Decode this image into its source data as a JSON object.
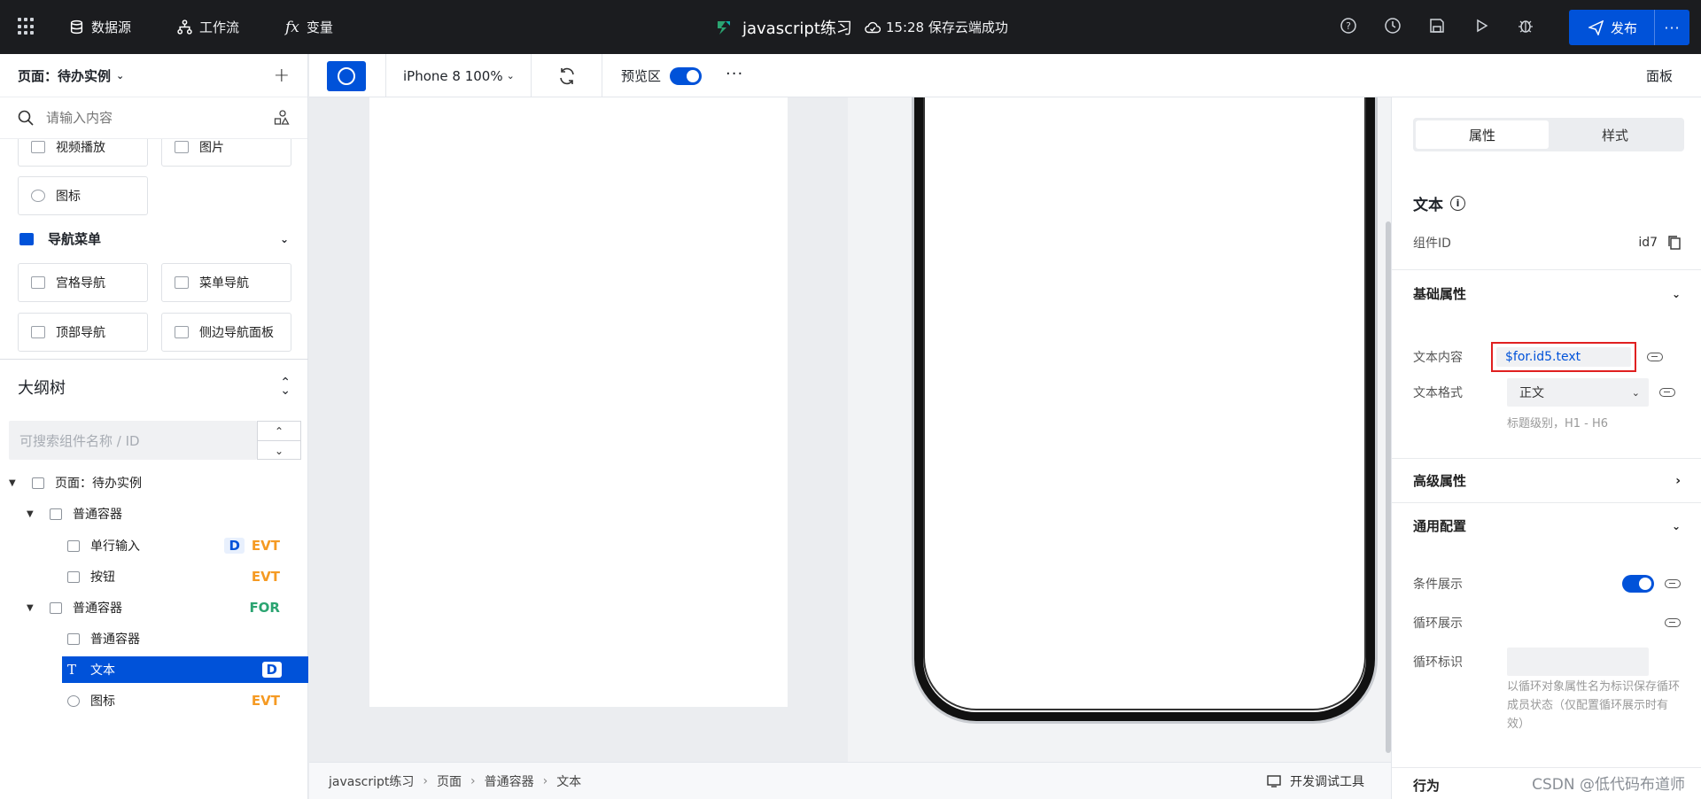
{
  "topbar": {
    "datasource": "数据源",
    "workflow": "工作流",
    "variables": "变量",
    "app_title": "javascript练习",
    "save_status": "15:28 保存云端成功",
    "publish": "发布"
  },
  "left": {
    "page_selector": "页面：待办实例",
    "search_placeholder": "请输入内容",
    "components": [
      "视频播放",
      "图片",
      "图标"
    ],
    "nav_section": "导航菜单",
    "nav_components": [
      "宫格导航",
      "菜单导航",
      "顶部导航",
      "侧边导航面板"
    ],
    "outline_title": "大纲树",
    "outline_search_placeholder": "可搜索组件名称 / ID",
    "tree": [
      {
        "label": "页面：待办实例"
      },
      {
        "label": "普通容器"
      },
      {
        "label": "单行输入",
        "tags": [
          "D",
          "EVT"
        ]
      },
      {
        "label": "按钮",
        "tags": [
          "EVT"
        ]
      },
      {
        "label": "普通容器",
        "tags": [
          "FOR"
        ]
      },
      {
        "label": "普通容器"
      },
      {
        "label": "文本",
        "tags": [
          "D"
        ]
      },
      {
        "label": "图标",
        "tags": [
          "EVT"
        ]
      }
    ]
  },
  "canvas": {
    "device": "iPhone 8 100%",
    "preview_label": "预览区",
    "panel_label": "面板",
    "breadcrumb": [
      "javascript练习",
      "页面",
      "普通容器",
      "文本"
    ],
    "dev_tools": "开发调试工具"
  },
  "right": {
    "tabs": [
      "属性",
      "样式"
    ],
    "title": "文本",
    "component_id_label": "组件ID",
    "component_id": "id7",
    "basic_section": "基础属性",
    "text_content_label": "文本内容",
    "text_content_value": "$for.id5.text",
    "text_format_label": "文本格式",
    "text_format_value": "正文",
    "text_format_hint": "标题级别，H1 - H6",
    "advanced_section": "高级属性",
    "common_section": "通用配置",
    "conditional_label": "条件展示",
    "loop_label": "循环展示",
    "loop_key_label": "循环标识",
    "loop_hint": "以循环对象属性名为标识保存循环成员状态（仅配置循环展示时有效）",
    "behavior_section": "行为"
  },
  "watermark": "CSDN @低代码布道师",
  "colors": {
    "accent": "#0052d9",
    "evt": "#f59a23",
    "for": "#2ba471",
    "topbar": "#1b1c1f",
    "highlight": "#e02020"
  }
}
